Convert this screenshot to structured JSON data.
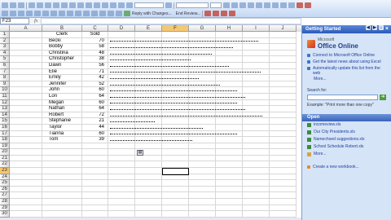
{
  "formula_bar": {
    "name_box": "F23",
    "fx": "fx"
  },
  "toolbar": {
    "reply_label": "Reply with Changes...",
    "end_review_label": "End Review..."
  },
  "columns": [
    "A",
    "B",
    "C",
    "D",
    "E",
    "F",
    "G",
    "H",
    "I",
    "J"
  ],
  "active_column": "F",
  "active_row": 23,
  "header_row": {
    "clerk": "Clerk",
    "sold": "Sold"
  },
  "data": [
    {
      "row": 2,
      "clerk": "Becki",
      "sold": 70
    },
    {
      "row": 3,
      "clerk": "Bobby",
      "sold": 58
    },
    {
      "row": 4,
      "clerk": "Christina",
      "sold": 48
    },
    {
      "row": 5,
      "clerk": "Christopher",
      "sold": 38
    },
    {
      "row": 6,
      "clerk": "Dawn",
      "sold": 56
    },
    {
      "row": 7,
      "clerk": "Elie",
      "sold": 71
    },
    {
      "row": 8,
      "clerk": "Emily",
      "sold": 42
    },
    {
      "row": 9,
      "clerk": "Jennifer",
      "sold": 52
    },
    {
      "row": 10,
      "clerk": "John",
      "sold": 60
    },
    {
      "row": 11,
      "clerk": "Lori",
      "sold": 64
    },
    {
      "row": 12,
      "clerk": "Megan",
      "sold": 60
    },
    {
      "row": 13,
      "clerk": "Nathan",
      "sold": 64
    },
    {
      "row": 14,
      "clerk": "Robert",
      "sold": 72
    },
    {
      "row": 15,
      "clerk": "Stephanie",
      "sold": 21
    },
    {
      "row": 16,
      "clerk": "Taylor",
      "sold": 44
    },
    {
      "row": 17,
      "clerk": "Tianna",
      "sold": 60
    },
    {
      "row": 18,
      "clerk": "Tom",
      "sold": 39
    }
  ],
  "total_rows": 31,
  "task_pane": {
    "title": "Getting Started",
    "logo_small": "Microsoft",
    "logo_text": "Office Online",
    "links": [
      "Connect to Microsoft Office Online",
      "Get the latest news about using Excel",
      "Automatically update this list from the web"
    ],
    "more": "More...",
    "search_label": "Search for:",
    "example": "Example: \"Print more than one copy\"",
    "open_header": "Open",
    "files": [
      "incomeview.xls",
      "Our City Presidents.xls",
      "Namechoed suggestions.xls",
      "School Schedule Robert.xls"
    ],
    "files_more": "More...",
    "new_workbook": "Create a new workbook..."
  },
  "colors": {
    "accent": "#2b5bb8",
    "pane_bg": "#d6e4f8",
    "active_header": "#f4c771"
  }
}
